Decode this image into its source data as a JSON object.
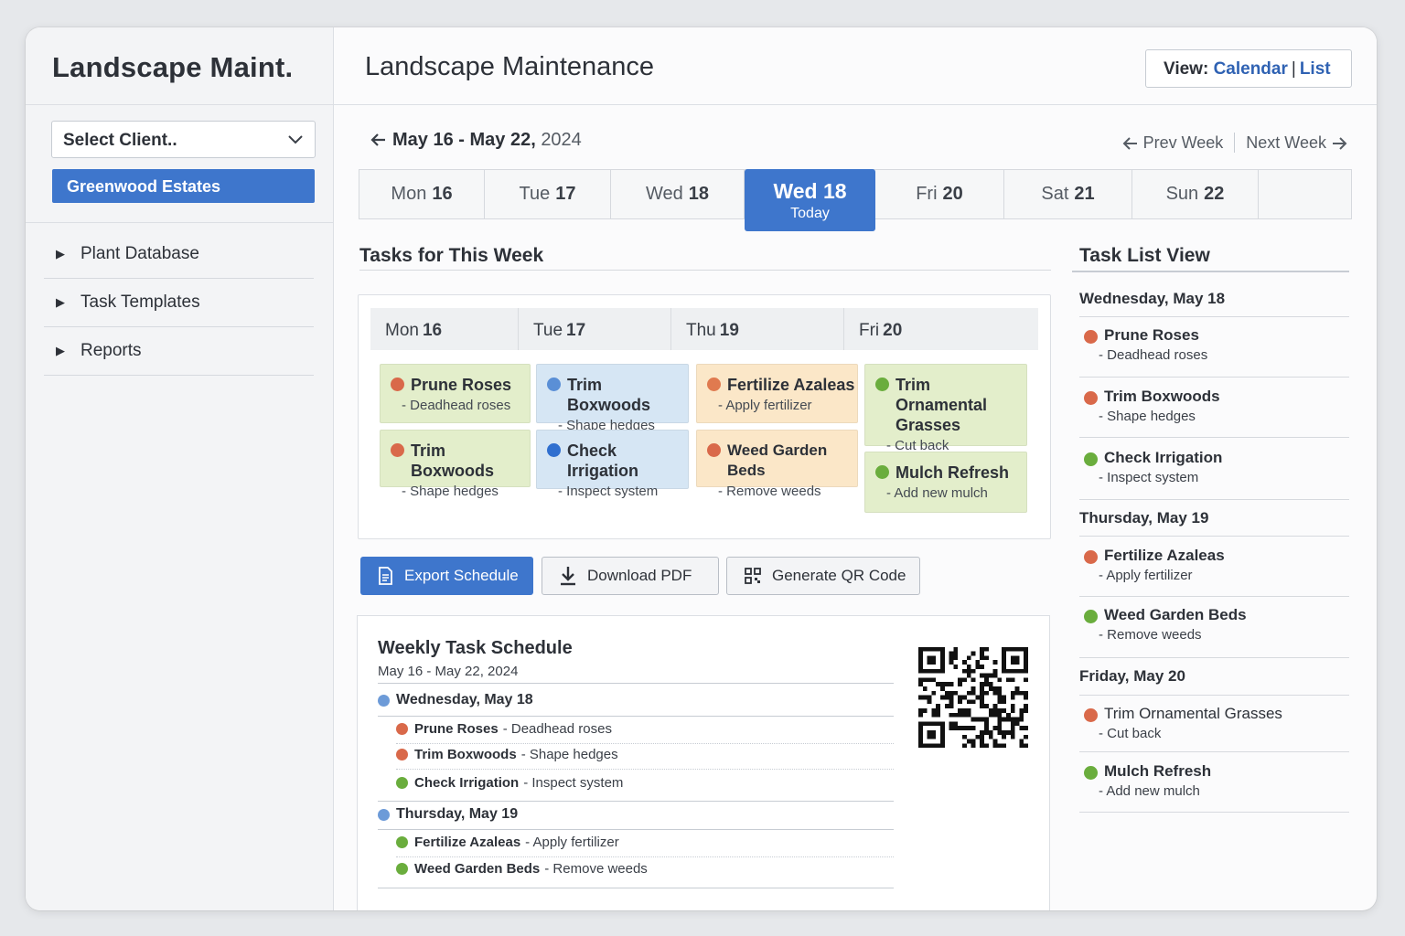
{
  "colors": {
    "accent": "#3e76cc",
    "red": "#d9694a",
    "blue": "#2f6fcf",
    "green": "#6aad3d",
    "orange": "#e07a4f",
    "day_dot": "#6d9bd8"
  },
  "sidebar": {
    "brand": "Landscape Maint.",
    "client_select": "Select Client..",
    "client_chip": "Greenwood Estates",
    "nav": [
      {
        "label": "Plant Database"
      },
      {
        "label": "Task Templates"
      },
      {
        "label": "Reports"
      }
    ]
  },
  "header": {
    "title": "Landscape Maintenance",
    "view_label": "View:",
    "view_calendar": "Calendar",
    "view_list": "List"
  },
  "week": {
    "range_bold": "May 16 - May 22,",
    "range_year": "2024",
    "prev": "Prev Week",
    "next": "Next Week",
    "tabs": [
      {
        "day": "Mon",
        "num": "16"
      },
      {
        "day": "Tue",
        "num": "17"
      },
      {
        "day": "Wed",
        "num": "18"
      },
      {
        "day": "Wed",
        "num": "18",
        "sub": "Today"
      },
      {
        "day": "Fri",
        "num": "20"
      },
      {
        "day": "Sat",
        "num": "21"
      },
      {
        "day": "Sun",
        "num": "22"
      }
    ]
  },
  "tasks": {
    "heading": "Tasks for This Week",
    "columns": [
      {
        "day": "Mon",
        "num": "16"
      },
      {
        "day": "Tue",
        "num": "17"
      },
      {
        "day": "Thu",
        "num": "19"
      },
      {
        "day": "Fri",
        "num": "20"
      }
    ],
    "cards": [
      {
        "title": "Prune Roses",
        "sub": "- Deadhead roses"
      },
      {
        "title": "Trim Boxwoods",
        "sub": "- Shape hedges"
      },
      {
        "title": "Trim Boxwoods",
        "sub": "- Shape hedges"
      },
      {
        "title": "Check Irrigation",
        "sub": "- Inspect system"
      },
      {
        "title": "Fertilize Azaleas",
        "sub": "- Apply fertilizer"
      },
      {
        "title": "Weed Garden Beds",
        "sub": "- Remove weeds"
      },
      {
        "title": "Trim Ornamental Grasses",
        "sub": "- Cut back"
      },
      {
        "title": "Mulch Refresh",
        "sub": "- Add new mulch"
      }
    ]
  },
  "actions": {
    "export": "Export Schedule",
    "pdf": "Download PDF",
    "qr": "Generate QR Code"
  },
  "schedule": {
    "title": "Weekly Task Schedule",
    "range": "May 16 - May 22, 2024",
    "days": [
      {
        "label": "Wednesday, May 18",
        "tasks": [
          {
            "name": "Prune Roses",
            "detail": "- Deadhead roses"
          },
          {
            "name": "Trim Boxwoods",
            "detail": "- Shape hedges"
          },
          {
            "name": "Check Irrigation",
            "detail": "- Inspect system"
          }
        ]
      },
      {
        "label": "Thursday, May 19",
        "tasks": [
          {
            "name": "Fertilize Azaleas",
            "detail": "- Apply fertilizer"
          },
          {
            "name": "Weed Garden Beds",
            "detail": "- Remove weeds"
          }
        ]
      }
    ]
  },
  "task_list": {
    "heading": "Task List View",
    "days": [
      {
        "label": "Wednesday, May 18",
        "tasks": [
          {
            "title": "Prune Roses",
            "sub": "- Deadhead roses"
          },
          {
            "title": "Trim Boxwoods",
            "sub": "- Shape hedges"
          },
          {
            "title": "Check Irrigation",
            "sub": "- Inspect system"
          }
        ]
      },
      {
        "label": "Thursday, May 19",
        "tasks": [
          {
            "title": "Fertilize Azaleas",
            "sub": "- Apply fertilizer"
          },
          {
            "title": "Weed Garden Beds",
            "sub": "- Remove weeds"
          }
        ]
      },
      {
        "label": "Friday, May 20",
        "tasks": [
          {
            "title": "Trim Ornamental Grasses",
            "sub": "- Cut back"
          },
          {
            "title": "Mulch Refresh",
            "sub": "- Add new mulch"
          }
        ]
      }
    ]
  }
}
